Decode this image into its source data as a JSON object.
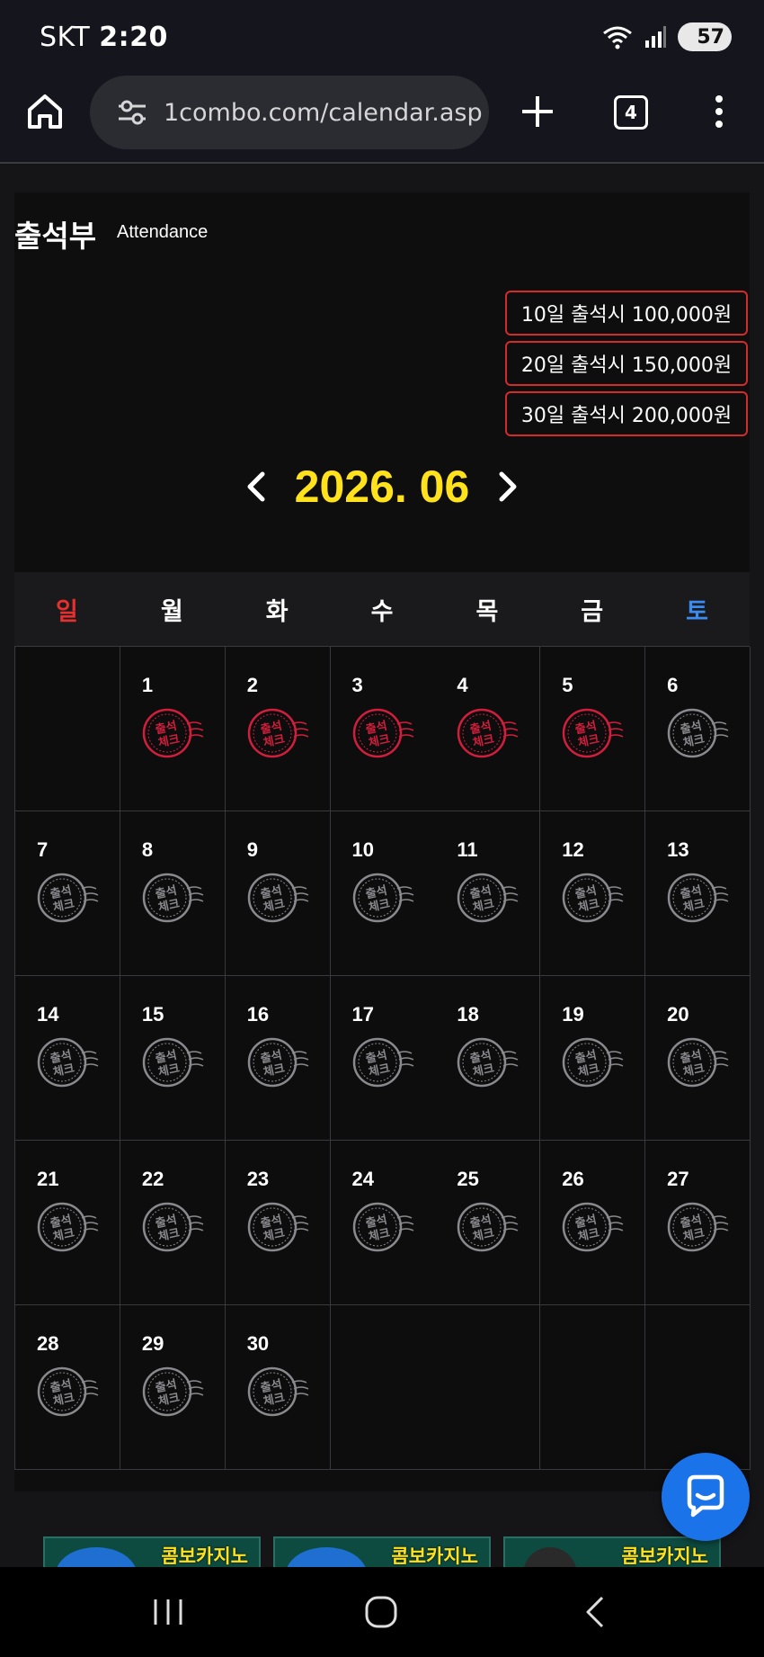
{
  "status_bar": {
    "carrier": "SKT",
    "time": "2:20",
    "battery": "57"
  },
  "browser": {
    "url": "1combo.com/calendar.asp",
    "tab_count": "4"
  },
  "page": {
    "title": "출석부",
    "subtitle": "Attendance",
    "bonuses": [
      "10일 출석시 100,000원",
      "20일 출석시 150,000원",
      "30일 출석시 200,000원"
    ],
    "month": "2026. 06"
  },
  "calendar": {
    "weekdays": [
      "일",
      "월",
      "화",
      "수",
      "목",
      "금",
      "토"
    ],
    "first_weekday_index": 1,
    "days_in_month": 30,
    "checked_days": [
      1,
      2,
      3,
      4,
      5
    ],
    "stamp_text": [
      "출석",
      "체크"
    ],
    "colors": {
      "checked": "#d21e3c",
      "unchecked": "#8a8a8e",
      "sunday": "#e53030",
      "saturday": "#3a8cf0",
      "month": "#ffe21c"
    }
  },
  "banners": [
    {
      "text": "콤보카지노"
    },
    {
      "text": "콤보카지노"
    },
    {
      "text": "콤보카지노"
    }
  ],
  "icons": [
    "home-icon",
    "tune-icon",
    "plus-icon",
    "tabs-icon",
    "more-vert-icon",
    "chat-icon",
    "recents-icon",
    "home-nav-icon",
    "back-icon"
  ]
}
